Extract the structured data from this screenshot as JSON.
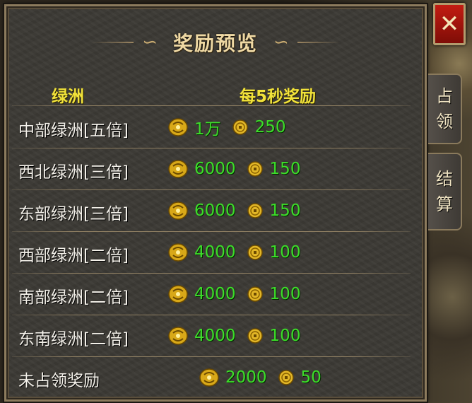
{
  "window": {
    "title": "奖励预览",
    "close_label": "✕"
  },
  "header": {
    "zone_label": "绿洲",
    "reward_label": "每5秒奖励"
  },
  "rows": [
    {
      "name": "中部绿洲[五倍]",
      "token_value": "1万",
      "coin_value": "250"
    },
    {
      "name": "西北绿洲[三倍]",
      "token_value": "6000",
      "coin_value": "150"
    },
    {
      "name": "东部绿洲[三倍]",
      "token_value": "6000",
      "coin_value": "150"
    },
    {
      "name": "西部绿洲[二倍]",
      "token_value": "4000",
      "coin_value": "100"
    },
    {
      "name": "南部绿洲[二倍]",
      "token_value": "4000",
      "coin_value": "100"
    },
    {
      "name": "东南绿洲[二倍]",
      "token_value": "4000",
      "coin_value": "100"
    }
  ],
  "unoccupied": {
    "name": "未占领奖励",
    "token_value": "2000",
    "coin_value": "50"
  },
  "side_tabs": [
    {
      "chars": [
        "占",
        "领"
      ]
    },
    {
      "chars": [
        "结",
        "算"
      ]
    }
  ],
  "icons": {
    "token": "gold-ingot-token-icon",
    "coin": "gold-coin-icon"
  },
  "colors": {
    "panel": "#3c3a35",
    "header_text": "#f1e23a",
    "value_text": "#3ddd2a",
    "title_text": "#efd9a4",
    "close_button": "#c21c12"
  }
}
